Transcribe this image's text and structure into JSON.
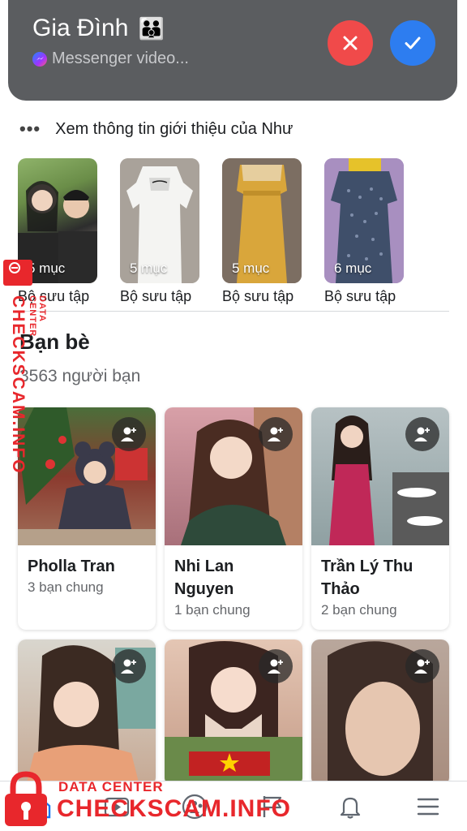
{
  "call": {
    "title": "Gia Đình",
    "title_emoji": "👪",
    "subtitle": "Messenger video...",
    "decline_color": "#f04a4a",
    "accept_color": "#2d7df0"
  },
  "intro": {
    "label": "Xem thông tin giới thiệu của Như"
  },
  "collections": [
    {
      "count": "5 mục",
      "label": "Bộ sưu tập"
    },
    {
      "count": "5 mục",
      "label": "Bộ sưu tập"
    },
    {
      "count": "5 mục",
      "label": "Bộ sưu tập"
    },
    {
      "count": "6 mục",
      "label": "Bộ sưu tập"
    }
  ],
  "friends": {
    "title": "Bạn bè",
    "count": "3563 người bạn",
    "items": [
      {
        "name": "Pholla Tran",
        "mutual": "3 bạn chung"
      },
      {
        "name": "Nhi Lan Nguyen",
        "mutual": "1 bạn chung"
      },
      {
        "name": "Trần Lý Thu Thảo",
        "mutual": "2 bạn chung"
      },
      {
        "name": "",
        "mutual": ""
      },
      {
        "name": "",
        "mutual": ""
      },
      {
        "name": "",
        "mutual": ""
      }
    ]
  },
  "nav": {
    "icons": [
      "home-icon",
      "watch-icon",
      "groups-icon",
      "pages-flag-icon",
      "notifications-bell-icon",
      "menu-icon"
    ]
  },
  "watermark": {
    "sub": "DATA CENTER",
    "main": "CHECKSCAM.INFO",
    "color": "#e8272c"
  }
}
